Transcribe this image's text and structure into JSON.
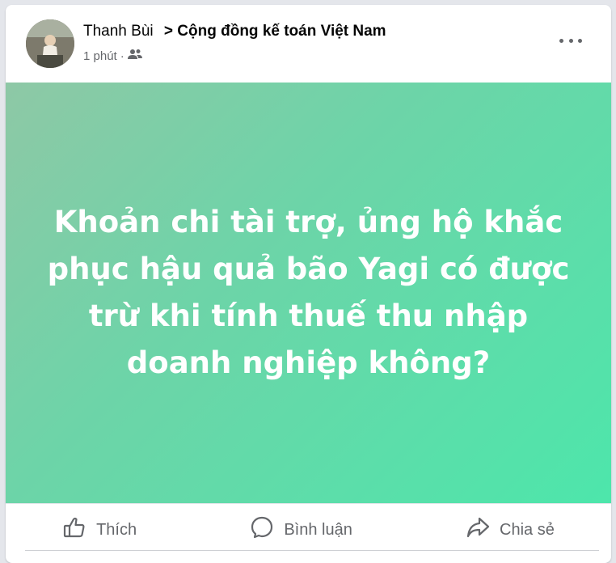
{
  "post": {
    "author": "Thanh Bùi",
    "arrow": ">",
    "group": "Cộng đồng kế toán Việt Nam",
    "time": "1 phút",
    "separator": "·",
    "privacy_icon": "group-icon",
    "more_icon": "more-options-icon",
    "banner_text": "Khoản chi tài trợ, ủng hộ khắc phục hậu quả bão Yagi có được trừ khi tính thuế thu nhập doanh nghiệp không?",
    "banner_colors": [
      "#8ec8a6",
      "#4de6ab"
    ]
  },
  "actions": {
    "like_label": "Thích",
    "like_icon": "thumbs-up-icon",
    "comment_label": "Bình luận",
    "comment_icon": "comment-icon",
    "share_label": "Chia sẻ",
    "share_icon": "share-icon"
  },
  "colors": {
    "text_primary": "#050505",
    "text_secondary": "#65676b",
    "background": "#e4e6eb"
  }
}
